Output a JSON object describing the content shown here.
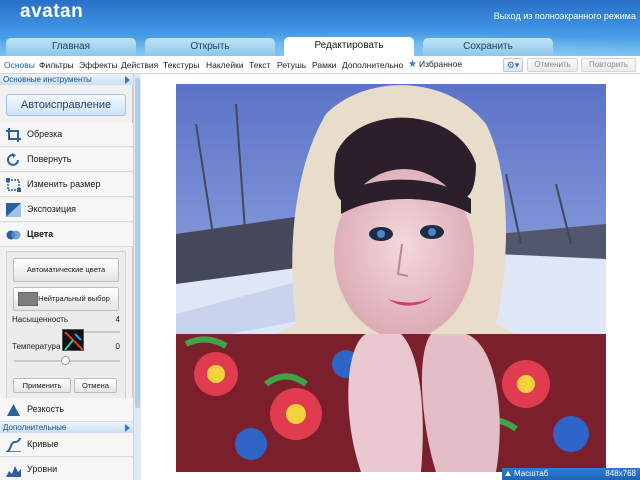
{
  "app": {
    "logo": "avatan",
    "exit_fullscreen": "Выход из полноэкранного режима"
  },
  "tabs": [
    {
      "label": "Главная",
      "active": false
    },
    {
      "label": "Открыть",
      "active": false
    },
    {
      "label": "Редактировать",
      "active": true
    },
    {
      "label": "Сохранить",
      "active": false
    }
  ],
  "toolbar": {
    "items": [
      "Основы",
      "Фильтры",
      "Эффекты",
      "Действия",
      "Текстуры",
      "Наклейки",
      "Текст",
      "Ретушь",
      "Рамки",
      "Дополнительно"
    ],
    "favorites": "Избранное",
    "undo": "Отменить",
    "redo": "Повторить"
  },
  "panel": {
    "section_basic": "Основные инструменты",
    "auto_fix": "Автоисправление",
    "tools": [
      {
        "label": "Обрезка",
        "icon": "crop-icon"
      },
      {
        "label": "Повернуть",
        "icon": "rotate-icon"
      },
      {
        "label": "Изменить размер",
        "icon": "resize-icon"
      },
      {
        "label": "Экспозиция",
        "icon": "exposure-icon"
      },
      {
        "label": "Цвета",
        "icon": "colors-icon"
      }
    ],
    "colors": {
      "auto_colors": "Автоматические цвета",
      "neutral_pick": "Нейтральный выбор",
      "saturation_label": "Насыщенность",
      "saturation_value": "4",
      "temperature_label": "Температура",
      "temperature_value": "0",
      "apply": "Применить",
      "cancel": "Отмена"
    },
    "sharpness": "Резкость",
    "section_extra": "Дополнительные",
    "curves": "Кривые",
    "levels": "Уровни"
  },
  "status": {
    "scale_label": "Масштаб",
    "image_size": "848x768"
  },
  "colors": {
    "accent": "#2c7ad6",
    "header": "#3b8ee0"
  }
}
